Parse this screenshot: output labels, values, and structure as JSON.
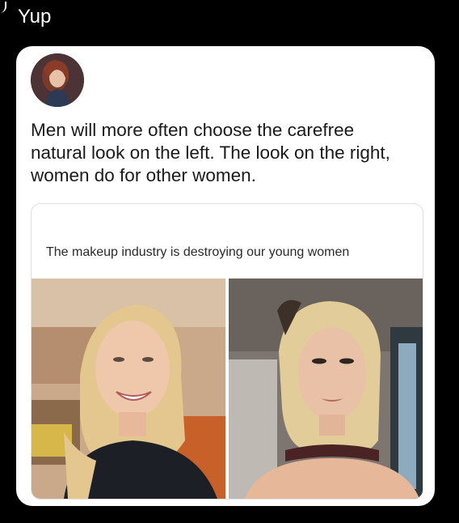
{
  "caption": "Yup",
  "post": {
    "text": "Men will more often choose the carefree\nnatural look on the left. The look on the right,\nwomen do for other women."
  },
  "quoted": {
    "text": "The makeup industry is destroying our young women"
  },
  "colors": {
    "background": "#000000",
    "card": "#ffffff",
    "text": "#1a1a1a"
  }
}
